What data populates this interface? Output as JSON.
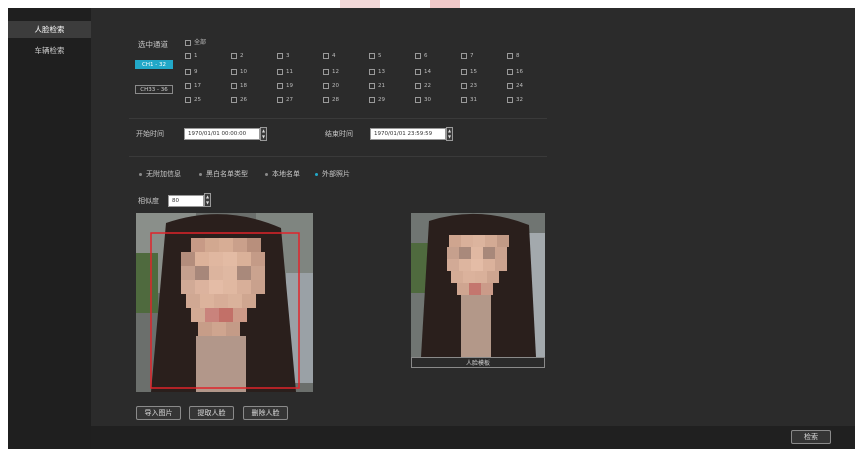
{
  "sidebar": {
    "items": [
      {
        "label": "人脸检索",
        "active": true
      },
      {
        "label": "车辆检索",
        "active": false
      }
    ]
  },
  "channel": {
    "section_label": "选中通道",
    "all_label": "全部",
    "groups": [
      {
        "label": "CH1 - 32",
        "active": true
      },
      {
        "label": "CH33 - 36",
        "active": false
      }
    ],
    "channels": [
      "1",
      "2",
      "3",
      "4",
      "5",
      "6",
      "7",
      "8",
      "9",
      "10",
      "11",
      "12",
      "13",
      "14",
      "15",
      "16",
      "17",
      "18",
      "19",
      "20",
      "21",
      "22",
      "23",
      "24",
      "25",
      "26",
      "27",
      "28",
      "29",
      "30",
      "31",
      "32"
    ]
  },
  "time": {
    "start_label": "开始时间",
    "start_value": "1970/01/01 00:00:00",
    "end_label": "结束时间",
    "end_value": "1970/01/01 23:59:59"
  },
  "source": {
    "options": [
      {
        "label": "无附加信息",
        "selected": false
      },
      {
        "label": "黑白名单类型",
        "selected": false
      },
      {
        "label": "本地名单",
        "selected": false
      },
      {
        "label": "外部照片",
        "selected": true
      }
    ]
  },
  "similarity": {
    "label": "相似度",
    "value": "80"
  },
  "photo": {
    "template_caption": "人脸模板"
  },
  "buttons": {
    "import": "导入图片",
    "extract": "提取人脸",
    "delete": "删除人脸",
    "search": "检索"
  },
  "colors": {
    "accent": "#22a8c8",
    "face_box": "#e0242a",
    "background": "#2b2b2b"
  }
}
